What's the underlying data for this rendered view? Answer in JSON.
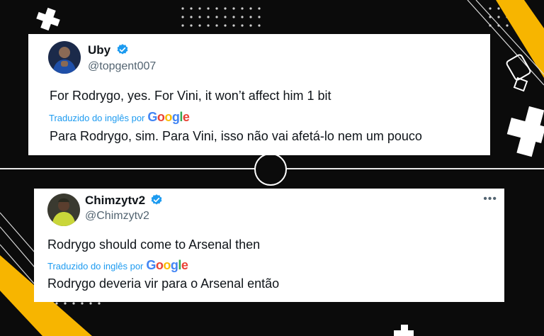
{
  "colors": {
    "background": "#0b0b0b",
    "accent_yellow": "#f7b500",
    "verified_blue": "#1d9bf0",
    "link_blue": "#1d9bf0",
    "handle_gray": "#536471",
    "text": "#0f1419"
  },
  "tweets": [
    {
      "display_name": "Uby",
      "handle": "@topgent007",
      "verified_icon": "verified-badge-icon",
      "text": "For Rodrygo, yes.  For Vini, it won’t affect him 1 bit",
      "translated_label": "Traduzido do inglês por",
      "translation": "Para Rodrygo, sim. Para Vini, isso não vai afetá-lo nem um pouco"
    },
    {
      "display_name": "Chimzytv2",
      "handle": "@Chimzytv2",
      "verified_icon": "verified-badge-icon",
      "more_icon": "more-options-icon",
      "more_glyph": "•••",
      "text": "Rodrygo should come to Arsenal then",
      "translated_label": "Traduzido do inglês por",
      "translation": "Rodrygo deveria vir para o Arsenal então"
    }
  ],
  "google_logo": {
    "letters": [
      "G",
      "o",
      "o",
      "g",
      "l",
      "e"
    ],
    "colors": [
      "#4285F4",
      "#EA4335",
      "#FBBC05",
      "#4285F4",
      "#34A853",
      "#EA4335"
    ]
  }
}
